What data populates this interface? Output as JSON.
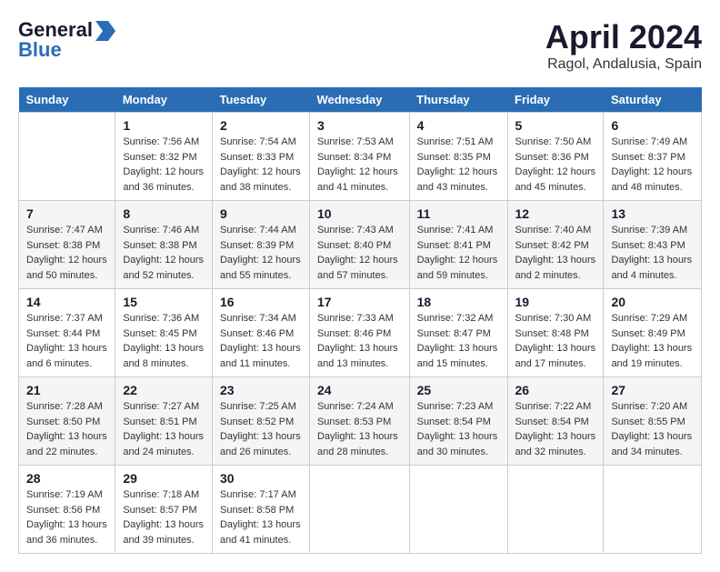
{
  "header": {
    "logo_general": "General",
    "logo_blue": "Blue",
    "title": "April 2024",
    "subtitle": "Ragol, Andalusia, Spain"
  },
  "days_of_week": [
    "Sunday",
    "Monday",
    "Tuesday",
    "Wednesday",
    "Thursday",
    "Friday",
    "Saturday"
  ],
  "weeks": [
    [
      {
        "day": "",
        "sunrise": "",
        "sunset": "",
        "daylight": ""
      },
      {
        "day": "1",
        "sunrise": "Sunrise: 7:56 AM",
        "sunset": "Sunset: 8:32 PM",
        "daylight": "Daylight: 12 hours and 36 minutes."
      },
      {
        "day": "2",
        "sunrise": "Sunrise: 7:54 AM",
        "sunset": "Sunset: 8:33 PM",
        "daylight": "Daylight: 12 hours and 38 minutes."
      },
      {
        "day": "3",
        "sunrise": "Sunrise: 7:53 AM",
        "sunset": "Sunset: 8:34 PM",
        "daylight": "Daylight: 12 hours and 41 minutes."
      },
      {
        "day": "4",
        "sunrise": "Sunrise: 7:51 AM",
        "sunset": "Sunset: 8:35 PM",
        "daylight": "Daylight: 12 hours and 43 minutes."
      },
      {
        "day": "5",
        "sunrise": "Sunrise: 7:50 AM",
        "sunset": "Sunset: 8:36 PM",
        "daylight": "Daylight: 12 hours and 45 minutes."
      },
      {
        "day": "6",
        "sunrise": "Sunrise: 7:49 AM",
        "sunset": "Sunset: 8:37 PM",
        "daylight": "Daylight: 12 hours and 48 minutes."
      }
    ],
    [
      {
        "day": "7",
        "sunrise": "Sunrise: 7:47 AM",
        "sunset": "Sunset: 8:38 PM",
        "daylight": "Daylight: 12 hours and 50 minutes."
      },
      {
        "day": "8",
        "sunrise": "Sunrise: 7:46 AM",
        "sunset": "Sunset: 8:38 PM",
        "daylight": "Daylight: 12 hours and 52 minutes."
      },
      {
        "day": "9",
        "sunrise": "Sunrise: 7:44 AM",
        "sunset": "Sunset: 8:39 PM",
        "daylight": "Daylight: 12 hours and 55 minutes."
      },
      {
        "day": "10",
        "sunrise": "Sunrise: 7:43 AM",
        "sunset": "Sunset: 8:40 PM",
        "daylight": "Daylight: 12 hours and 57 minutes."
      },
      {
        "day": "11",
        "sunrise": "Sunrise: 7:41 AM",
        "sunset": "Sunset: 8:41 PM",
        "daylight": "Daylight: 12 hours and 59 minutes."
      },
      {
        "day": "12",
        "sunrise": "Sunrise: 7:40 AM",
        "sunset": "Sunset: 8:42 PM",
        "daylight": "Daylight: 13 hours and 2 minutes."
      },
      {
        "day": "13",
        "sunrise": "Sunrise: 7:39 AM",
        "sunset": "Sunset: 8:43 PM",
        "daylight": "Daylight: 13 hours and 4 minutes."
      }
    ],
    [
      {
        "day": "14",
        "sunrise": "Sunrise: 7:37 AM",
        "sunset": "Sunset: 8:44 PM",
        "daylight": "Daylight: 13 hours and 6 minutes."
      },
      {
        "day": "15",
        "sunrise": "Sunrise: 7:36 AM",
        "sunset": "Sunset: 8:45 PM",
        "daylight": "Daylight: 13 hours and 8 minutes."
      },
      {
        "day": "16",
        "sunrise": "Sunrise: 7:34 AM",
        "sunset": "Sunset: 8:46 PM",
        "daylight": "Daylight: 13 hours and 11 minutes."
      },
      {
        "day": "17",
        "sunrise": "Sunrise: 7:33 AM",
        "sunset": "Sunset: 8:46 PM",
        "daylight": "Daylight: 13 hours and 13 minutes."
      },
      {
        "day": "18",
        "sunrise": "Sunrise: 7:32 AM",
        "sunset": "Sunset: 8:47 PM",
        "daylight": "Daylight: 13 hours and 15 minutes."
      },
      {
        "day": "19",
        "sunrise": "Sunrise: 7:30 AM",
        "sunset": "Sunset: 8:48 PM",
        "daylight": "Daylight: 13 hours and 17 minutes."
      },
      {
        "day": "20",
        "sunrise": "Sunrise: 7:29 AM",
        "sunset": "Sunset: 8:49 PM",
        "daylight": "Daylight: 13 hours and 19 minutes."
      }
    ],
    [
      {
        "day": "21",
        "sunrise": "Sunrise: 7:28 AM",
        "sunset": "Sunset: 8:50 PM",
        "daylight": "Daylight: 13 hours and 22 minutes."
      },
      {
        "day": "22",
        "sunrise": "Sunrise: 7:27 AM",
        "sunset": "Sunset: 8:51 PM",
        "daylight": "Daylight: 13 hours and 24 minutes."
      },
      {
        "day": "23",
        "sunrise": "Sunrise: 7:25 AM",
        "sunset": "Sunset: 8:52 PM",
        "daylight": "Daylight: 13 hours and 26 minutes."
      },
      {
        "day": "24",
        "sunrise": "Sunrise: 7:24 AM",
        "sunset": "Sunset: 8:53 PM",
        "daylight": "Daylight: 13 hours and 28 minutes."
      },
      {
        "day": "25",
        "sunrise": "Sunrise: 7:23 AM",
        "sunset": "Sunset: 8:54 PM",
        "daylight": "Daylight: 13 hours and 30 minutes."
      },
      {
        "day": "26",
        "sunrise": "Sunrise: 7:22 AM",
        "sunset": "Sunset: 8:54 PM",
        "daylight": "Daylight: 13 hours and 32 minutes."
      },
      {
        "day": "27",
        "sunrise": "Sunrise: 7:20 AM",
        "sunset": "Sunset: 8:55 PM",
        "daylight": "Daylight: 13 hours and 34 minutes."
      }
    ],
    [
      {
        "day": "28",
        "sunrise": "Sunrise: 7:19 AM",
        "sunset": "Sunset: 8:56 PM",
        "daylight": "Daylight: 13 hours and 36 minutes."
      },
      {
        "day": "29",
        "sunrise": "Sunrise: 7:18 AM",
        "sunset": "Sunset: 8:57 PM",
        "daylight": "Daylight: 13 hours and 39 minutes."
      },
      {
        "day": "30",
        "sunrise": "Sunrise: 7:17 AM",
        "sunset": "Sunset: 8:58 PM",
        "daylight": "Daylight: 13 hours and 41 minutes."
      },
      {
        "day": "",
        "sunrise": "",
        "sunset": "",
        "daylight": ""
      },
      {
        "day": "",
        "sunrise": "",
        "sunset": "",
        "daylight": ""
      },
      {
        "day": "",
        "sunrise": "",
        "sunset": "",
        "daylight": ""
      },
      {
        "day": "",
        "sunrise": "",
        "sunset": "",
        "daylight": ""
      }
    ]
  ]
}
